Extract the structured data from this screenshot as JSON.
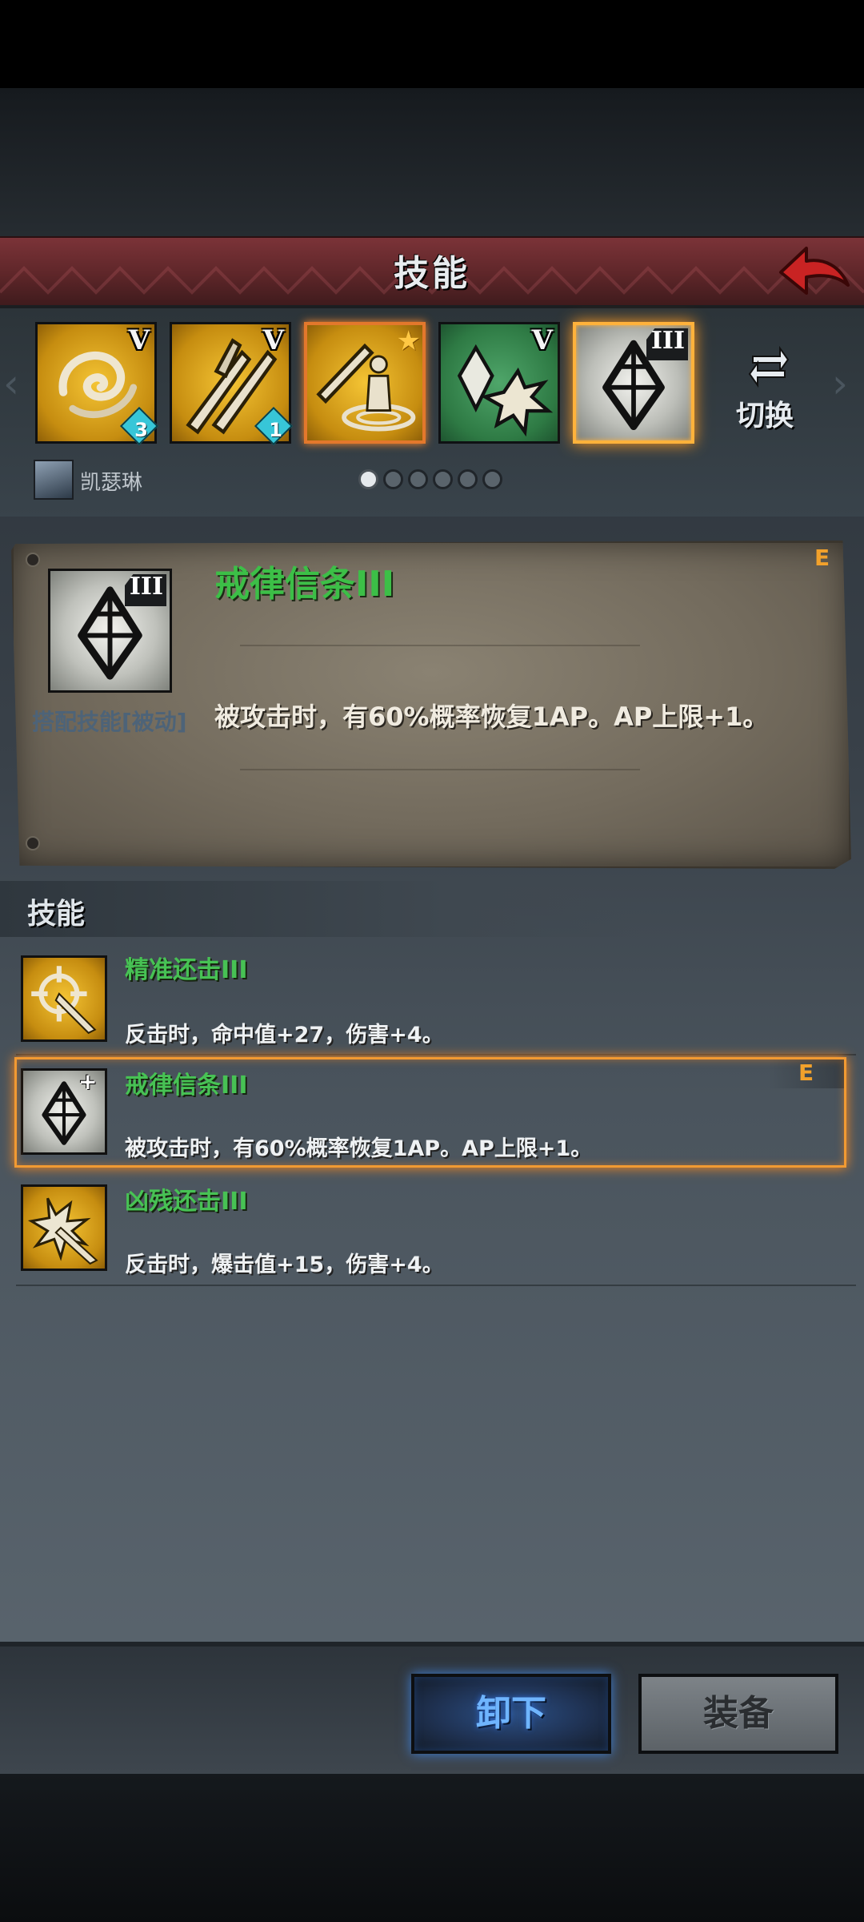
{
  "header": {
    "title": "技能",
    "back_icon": "back-arrow-icon"
  },
  "skill_slots": [
    {
      "roman": "V",
      "badge": "3",
      "icon": "whirlwind-icon"
    },
    {
      "roman": "V",
      "badge": "1",
      "icon": "crossed-swords-icon"
    },
    {
      "roman": "",
      "badge": "",
      "icon": "sword-warrior-icon",
      "star": "★"
    },
    {
      "roman": "V",
      "badge": "",
      "icon": "crystal-burst-icon"
    },
    {
      "roman": "III",
      "badge": "",
      "icon": "crystal-icon"
    }
  ],
  "switch": {
    "label": "切换",
    "icon": "swap-arrows-icon"
  },
  "character": {
    "name": "凯瑟琳"
  },
  "pagination": {
    "total": 6,
    "active": 1
  },
  "detail": {
    "title": "戒律信条III",
    "type": "搭配技能[被动]",
    "description": "被攻击时，有60%概率恢复1AP。AP上限+1。",
    "equipped_mark": "E",
    "icon_roman": "III"
  },
  "section": {
    "label": "技能"
  },
  "skills": [
    {
      "title": "精准还击III",
      "description": "反击时，命中值+27，伤害+4。",
      "icon": "crosshair-counter-icon",
      "equipped": ""
    },
    {
      "title": "戒律信条III",
      "description": "被攻击时，有60%概率恢复1AP。AP上限+1。",
      "icon": "crystal-icon",
      "equipped": "E"
    },
    {
      "title": "凶残还击III",
      "description": "反击时，爆击值+15，伤害+4。",
      "icon": "burst-counter-icon",
      "equipped": ""
    }
  ],
  "buttons": {
    "unequip": "卸下",
    "equip": "装备"
  },
  "colors": {
    "accent_orange": "#f29a32",
    "skill_title_green": "#47c254",
    "header_red": "#7b3338",
    "unequip_blue": "#6fb5ff"
  }
}
